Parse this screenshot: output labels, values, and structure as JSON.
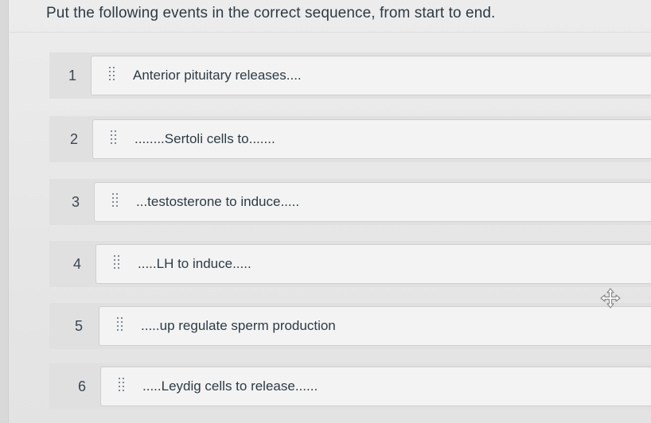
{
  "question": {
    "prompt": "Put the following events in the correct sequence, from start to end."
  },
  "items": [
    {
      "number": "1",
      "label": "Anterior pituitary releases...."
    },
    {
      "number": "2",
      "label": "........Sertoli cells to......."
    },
    {
      "number": "3",
      "label": "...testosterone to induce....."
    },
    {
      "number": "4",
      "label": ".....LH to induce....."
    },
    {
      "number": "5",
      "label": ".....up regulate sperm production"
    },
    {
      "number": "6",
      "label": ".....Leydig cells to release......"
    }
  ],
  "icons": {
    "drag_handle": "grip-dots-icon",
    "move_cursor": "move-cursor-icon"
  }
}
